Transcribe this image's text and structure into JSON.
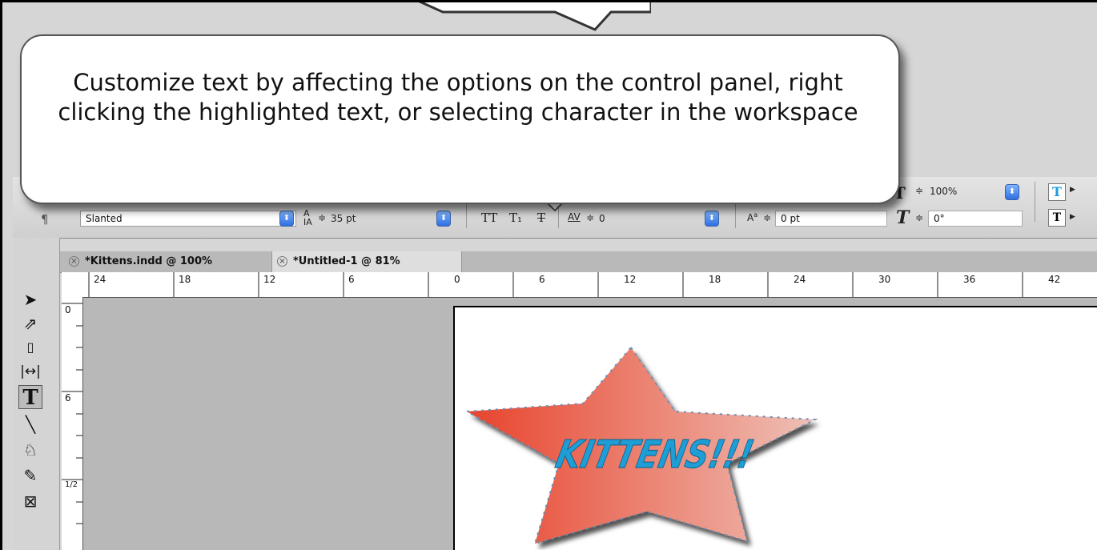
{
  "callout": {
    "text": "Customize text by affecting the options on the control panel, right clicking the highlighted text, or selecting character in the workspace"
  },
  "control_panel": {
    "paragraph_icon": "¶",
    "font_style": "Slanted",
    "leading": "35 pt",
    "tracking": "0",
    "baseline_shift": "0 pt",
    "horizontal_scale": "100%",
    "skew": "0°",
    "all_caps_glyph": "TT",
    "subscript_glyph": "T₁",
    "strikethrough_glyph": "T"
  },
  "tabs": [
    {
      "label": "*Kittens.indd @ 100%"
    },
    {
      "label": "*Untitled-1 @ 81%"
    }
  ],
  "hruler": {
    "labels": [
      "24",
      "18",
      "12",
      "6",
      "0",
      "6",
      "12",
      "18",
      "24",
      "30",
      "36",
      "42"
    ]
  },
  "vruler": {
    "labels": [
      "0",
      "6",
      "1/2"
    ]
  },
  "canvas": {
    "headline": "KITTENS!!!",
    "star_fill_start": "#e8432c",
    "star_fill_end": "#eec0b6",
    "text_color": "#1f9ed6"
  }
}
